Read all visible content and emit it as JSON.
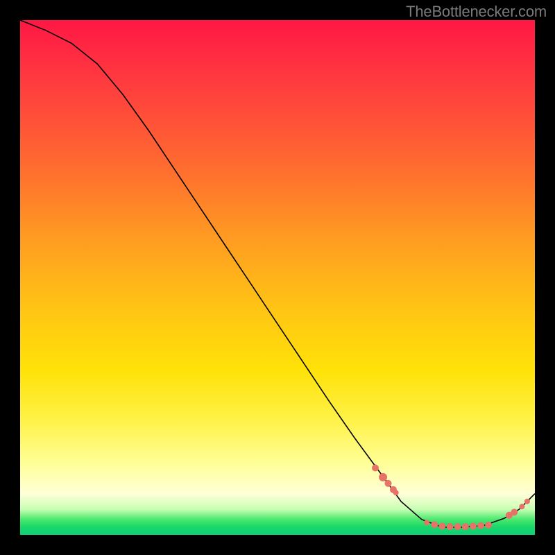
{
  "attribution": "TheBottlenecker.com",
  "chart_data": {
    "type": "line",
    "title": "",
    "xlabel": "",
    "ylabel": "",
    "xlim": [
      0,
      100
    ],
    "ylim": [
      0,
      100
    ],
    "curve": [
      {
        "x": 0.0,
        "y": 100.0
      },
      {
        "x": 5.0,
        "y": 98.0
      },
      {
        "x": 10.0,
        "y": 95.5
      },
      {
        "x": 15.0,
        "y": 91.5
      },
      {
        "x": 20.0,
        "y": 85.5
      },
      {
        "x": 25.0,
        "y": 78.5
      },
      {
        "x": 30.0,
        "y": 71.0
      },
      {
        "x": 35.0,
        "y": 63.5
      },
      {
        "x": 40.0,
        "y": 56.0
      },
      {
        "x": 45.0,
        "y": 48.5
      },
      {
        "x": 50.0,
        "y": 41.0
      },
      {
        "x": 55.0,
        "y": 33.5
      },
      {
        "x": 60.0,
        "y": 26.0
      },
      {
        "x": 65.0,
        "y": 18.8
      },
      {
        "x": 70.0,
        "y": 12.0
      },
      {
        "x": 74.0,
        "y": 6.5
      },
      {
        "x": 78.0,
        "y": 3.0
      },
      {
        "x": 82.0,
        "y": 1.5
      },
      {
        "x": 86.0,
        "y": 1.5
      },
      {
        "x": 90.0,
        "y": 1.8
      },
      {
        "x": 94.0,
        "y": 3.2
      },
      {
        "x": 97.0,
        "y": 5.0
      },
      {
        "x": 100.0,
        "y": 8.0
      }
    ],
    "points": [
      {
        "x": 69.0,
        "y": 13.0,
        "r": 5
      },
      {
        "x": 70.5,
        "y": 11.2,
        "r": 6
      },
      {
        "x": 71.5,
        "y": 10.0,
        "r": 5
      },
      {
        "x": 72.5,
        "y": 8.8,
        "r": 5
      },
      {
        "x": 73.0,
        "y": 8.2,
        "r": 4
      },
      {
        "x": 79.0,
        "y": 2.4,
        "r": 4
      },
      {
        "x": 80.5,
        "y": 2.0,
        "r": 5
      },
      {
        "x": 82.0,
        "y": 1.7,
        "r": 5
      },
      {
        "x": 83.5,
        "y": 1.6,
        "r": 5
      },
      {
        "x": 85.0,
        "y": 1.6,
        "r": 5
      },
      {
        "x": 86.5,
        "y": 1.6,
        "r": 5
      },
      {
        "x": 88.0,
        "y": 1.7,
        "r": 5
      },
      {
        "x": 89.5,
        "y": 1.8,
        "r": 5
      },
      {
        "x": 91.0,
        "y": 1.9,
        "r": 5
      },
      {
        "x": 95.0,
        "y": 3.8,
        "r": 5
      },
      {
        "x": 96.0,
        "y": 4.4,
        "r": 5
      },
      {
        "x": 97.5,
        "y": 5.5,
        "r": 4
      },
      {
        "x": 98.5,
        "y": 6.5,
        "r": 4
      }
    ]
  },
  "colors": {
    "dot": "#e77368",
    "curve": "#000000"
  }
}
